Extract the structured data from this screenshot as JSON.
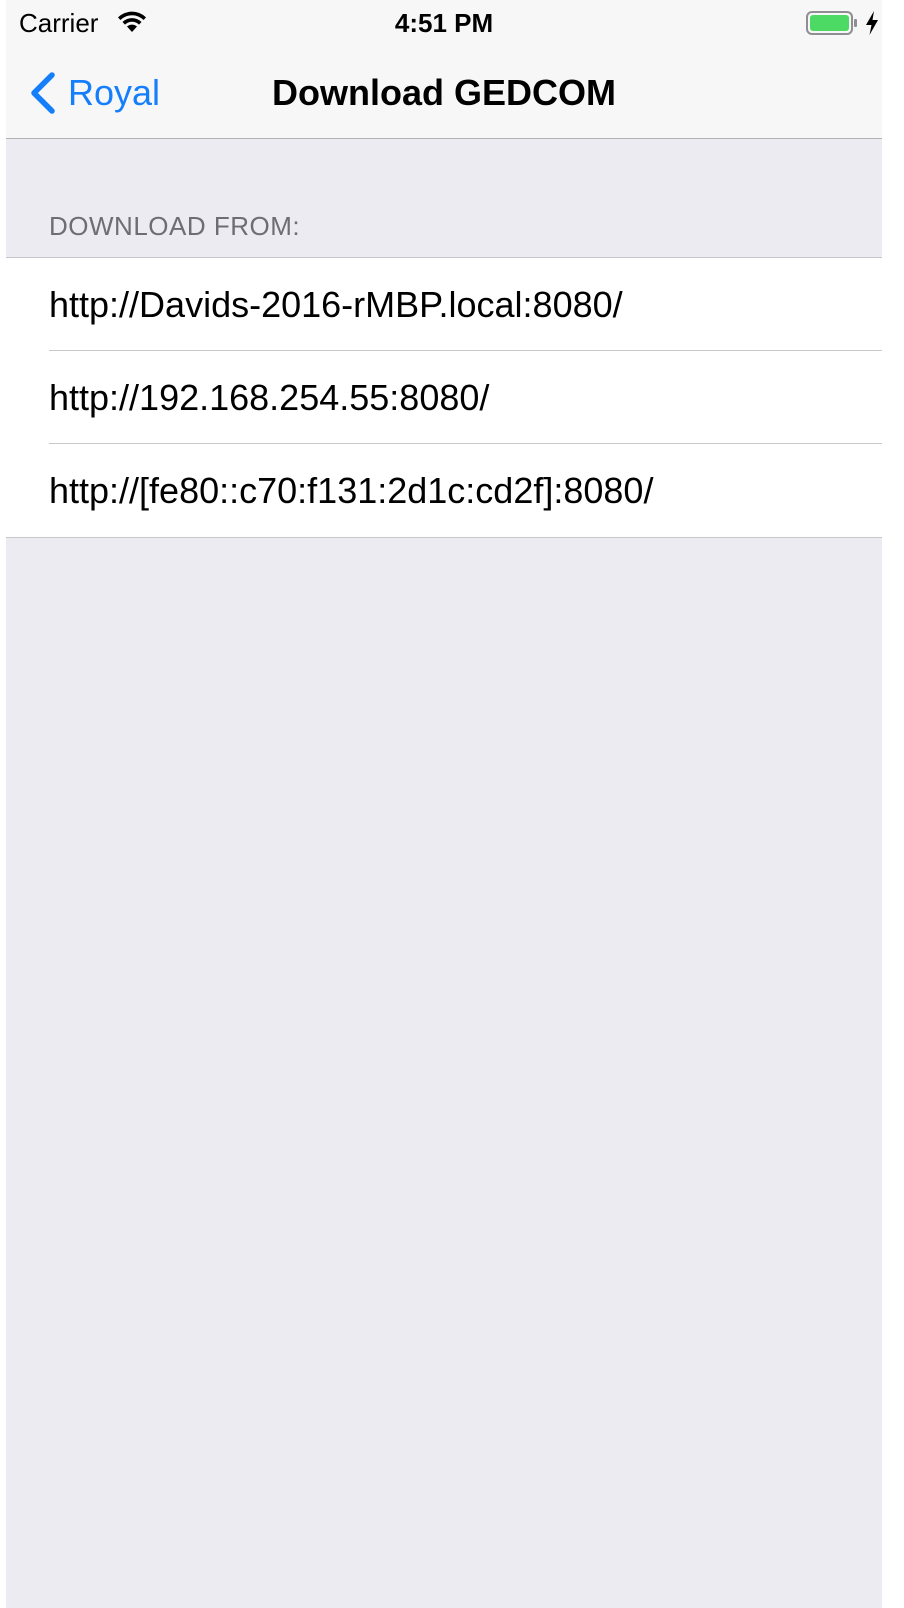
{
  "status_bar": {
    "carrier": "Carrier",
    "time": "4:51 PM",
    "wifi_icon": "wifi-icon",
    "battery_icon": "battery-full-icon",
    "charging_icon": "charging-bolt-icon",
    "battery_color": "#4cd964"
  },
  "nav": {
    "back_label": "Royal",
    "back_icon": "chevron-left-icon",
    "title": "Download GEDCOM",
    "accent_color": "#157efb"
  },
  "section": {
    "header": "DOWNLOAD FROM:",
    "items": [
      {
        "label": "http://Davids-2016-rMBP.local:8080/"
      },
      {
        "label": "http://192.168.254.55:8080/"
      },
      {
        "label": "http://[fe80::c70:f131:2d1c:cd2f]:8080/"
      }
    ]
  }
}
